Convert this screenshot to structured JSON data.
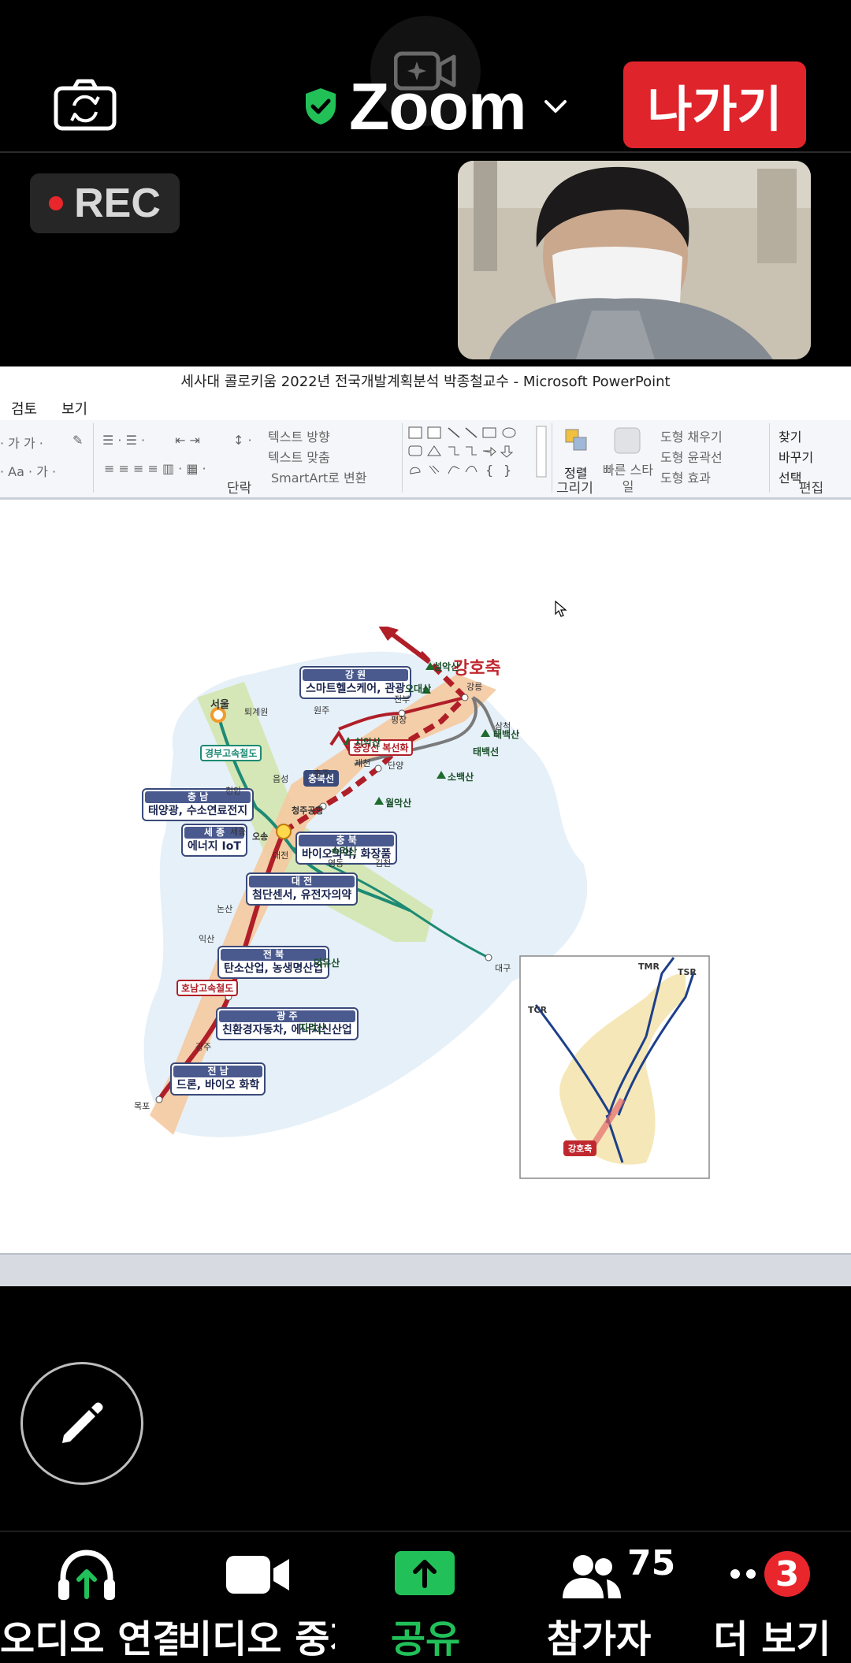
{
  "header": {
    "app_title": "Zoom",
    "leave_label": "나가기",
    "rec_label": "REC"
  },
  "share": {
    "window_title": "세사대 콜로키움 2022년 전국개발계획분석 박종철교수 - Microsoft PowerPoint",
    "tabs": [
      "검토",
      "보기"
    ],
    "ribbon": {
      "paragraph_group": "단락",
      "drawing_group": "그리기",
      "editing_group": "편집",
      "text_direction": "텍스트 방향",
      "text_align": "텍스트 맞춤",
      "smartart": "SmartArt로 변환",
      "arrange": "정렬",
      "quick_styles": "빠른 스타일",
      "shape_fill": "도형 채우기",
      "shape_outline": "도형 윤곽선",
      "shape_effects": "도형 효과",
      "find": "찾기",
      "replace": "바꾸기",
      "select": "선택"
    }
  },
  "slide": {
    "ganghochuk": "강호축",
    "regions": [
      {
        "head": "강 원",
        "body": "스마트헬스케어, 관광"
      },
      {
        "head": "충 남",
        "body": "태양광, 수소연료전지"
      },
      {
        "head": "세 종",
        "body": "에너지 IoT"
      },
      {
        "head": "대 전",
        "body": "첨단센서, 유전자의약"
      },
      {
        "head": "충 북",
        "body": "바이오의약, 화장품"
      },
      {
        "head": "전 북",
        "body": "탄소산업, 농생명산업"
      },
      {
        "head": "광 주",
        "body": "친환경자동차, 에너지신산업"
      },
      {
        "head": "전 남",
        "body": "드론, 바이오 화학"
      }
    ],
    "lines": {
      "gyeongbu": "경부고속철도",
      "honam": "호남고속철도",
      "jungang": "중앙선 복선화",
      "chungbuk": "충북선",
      "taebaek": "태백선"
    },
    "places": {
      "seoul": "서울",
      "osong": "오송",
      "cheongju_airport": "청주공항",
      "daejeon": "대전",
      "mokpo": "목포",
      "gwangju": "광주",
      "iksan": "익산",
      "nonsan": "논산",
      "cheonan": "천안",
      "sejong": "세종",
      "wonju": "원주",
      "jecheon": "제천",
      "chungju": "충주",
      "gangneung": "강릉",
      "samcheok": "삼척",
      "danyang": "단양",
      "daegu": "대구",
      "gimcheon": "김천",
      "yeongdong": "영동",
      "pyeongchang": "평창",
      "jinbu": "진부",
      "toegyewon": "퇴계원",
      "eumseong": "음성"
    },
    "mountains": {
      "seorak": "설악산",
      "odae": "오대산",
      "taebaek": "태백산",
      "chiak": "치악산",
      "sobaek": "소백산",
      "worak": "월악산",
      "songni": "속리산",
      "deogyu": "덕유산",
      "jiri": "지리산"
    },
    "inset": {
      "tmr": "TMR",
      "tsr": "TSR",
      "tcr": "TCR",
      "tag": "강호축"
    }
  },
  "bottom_bar": {
    "audio": "오디오 연결",
    "video": "비디오 중지",
    "share": "공유",
    "participants": "참가자",
    "participants_count": "75",
    "more": "더 보기",
    "more_badge": "3"
  },
  "colors": {
    "leave": "#e0242b",
    "share_active": "#21c059",
    "badge": "#e8262c"
  }
}
